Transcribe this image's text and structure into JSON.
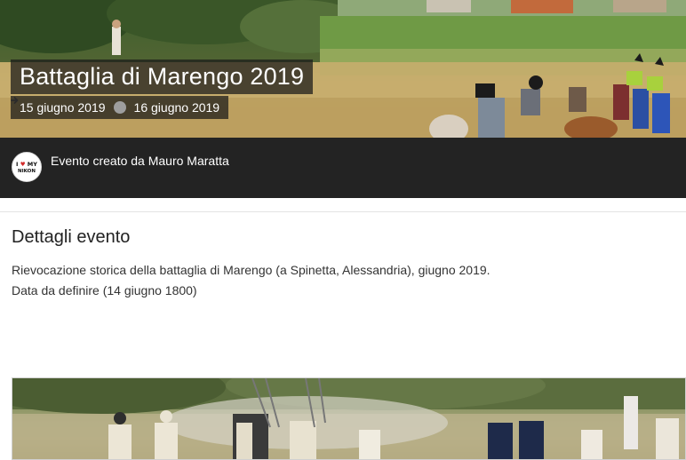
{
  "event": {
    "title": "Battaglia di Marengo 2019",
    "start_date": "15 giugno 2019",
    "end_date": "16 giugno 2019"
  },
  "creator": {
    "avatar_icon": "i-love-my-nikon-logo",
    "avatar_text": "I ♥ MY NIKON",
    "text": "Evento creato da Mauro Maratta"
  },
  "details": {
    "heading": "Dettagli evento",
    "description_line1": "Rievocazione storica della battaglia di Marengo (a Spinetta, Alessandria), giugno 2019.",
    "description_line2": "Data da definire (14 giugno 1800)"
  },
  "icons": {
    "date_separator": "arrow-right-circle-icon"
  },
  "colors": {
    "creator_bar": "#232323",
    "overlay": "#191919"
  }
}
